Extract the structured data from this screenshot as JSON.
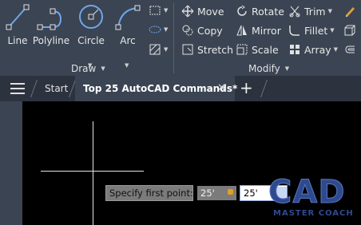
{
  "ribbon": {
    "draw": {
      "title": "Draw",
      "line": "Line",
      "polyline": "Polyline",
      "circle": "Circle",
      "arc": "Arc"
    },
    "modify": {
      "title": "Modify",
      "move": "Move",
      "rotate": "Rotate",
      "trim": "Trim",
      "copy": "Copy",
      "mirror": "Mirror",
      "fillet": "Fillet",
      "stretch": "Stretch",
      "scale": "Scale",
      "array": "Array"
    }
  },
  "tabs": {
    "start": "Start",
    "active": "Top 25 AutoCAD Commands*",
    "close": "✕",
    "new": "+"
  },
  "command": {
    "prompt": "Specify first point:",
    "x_value": "25'",
    "y_value": "25'"
  },
  "logo": {
    "big": "CAD",
    "small": "MASTER COACH"
  }
}
